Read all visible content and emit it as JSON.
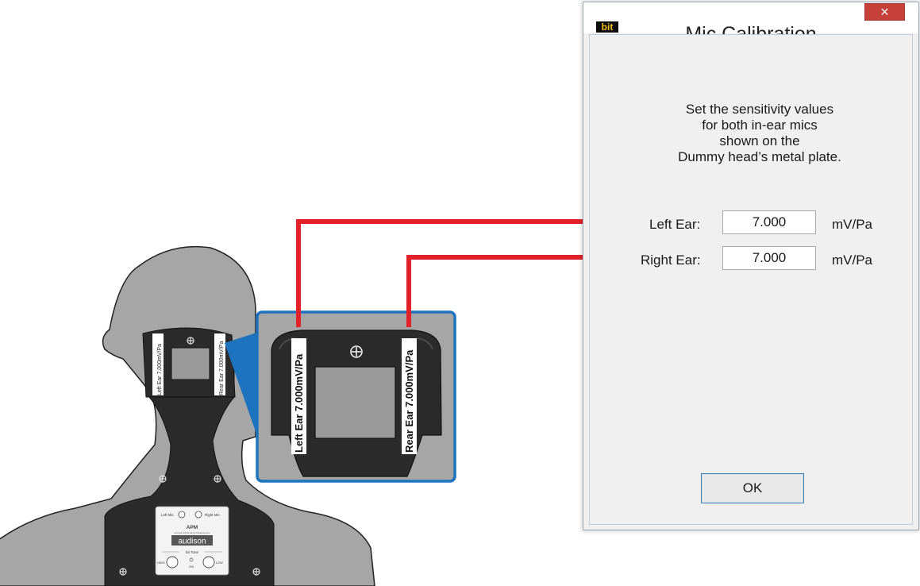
{
  "window": {
    "title": "Mic Calibration",
    "icon": "bit-logo-icon",
    "icon_text": "bit",
    "close_glyph": "×"
  },
  "instructions": [
    "Set the sensitivity values",
    "for both in-ear mics",
    "shown on the",
    "Dummy head’s metal plate."
  ],
  "fields": {
    "left": {
      "label": "Left Ear:",
      "value": "7.000",
      "unit": "mV/Pa"
    },
    "right": {
      "label": "Right Ear:",
      "value": "7.000",
      "unit": "mV/Pa"
    }
  },
  "ok_label": "OK",
  "plate": {
    "left_label": "Left Ear 7.000mV/Pa",
    "right_label": "Rear Ear 7.000mV/Pa"
  },
  "panel": {
    "left_mic": "Left Mic",
    "right_mic": "Right Mic",
    "model": "APM",
    "model_sub": "Acoustic Performance Measurement",
    "brand": "audison",
    "bit_tune": "bit Tune",
    "high": "HIGH",
    "on": "ON",
    "low": "LOW"
  },
  "colors": {
    "arrow": "#e3212b",
    "callout_border": "#1e73be",
    "plate": "#2b2b2b",
    "head": "#a6a6a6",
    "close": "#c6413a"
  }
}
